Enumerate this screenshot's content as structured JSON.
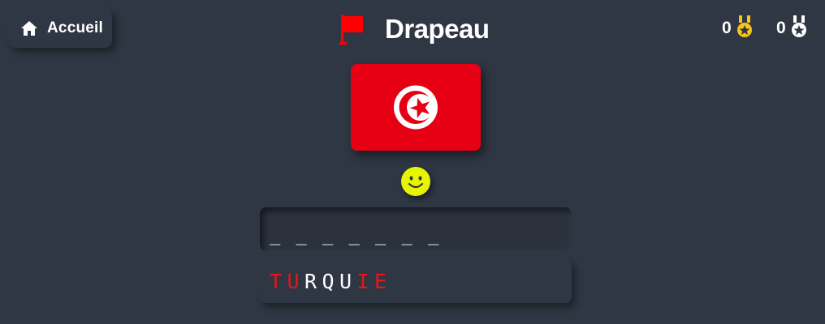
{
  "header": {
    "home_label": "Accueil",
    "home_icon": "home-icon",
    "title": "Drapeau",
    "title_icon": "flag-icon",
    "title_icon_color": "#ff0000"
  },
  "scores": {
    "gold": {
      "value": "0",
      "icon": "gold-medal-icon",
      "color": "#f5c518"
    },
    "silver": {
      "value": "0",
      "icon": "silver-medal-icon",
      "color": "#ffffff"
    }
  },
  "flag": {
    "country_icon": "tunisia-flag",
    "background_color": "#e70013"
  },
  "feedback": {
    "icon": "smiley-icon",
    "color": "#e8f500"
  },
  "answer": {
    "slots": "_ _ _ _ _ _ _"
  },
  "guess": {
    "letters": [
      {
        "char": "T",
        "status": "wrong"
      },
      {
        "char": "U",
        "status": "wrong"
      },
      {
        "char": "R",
        "status": "ok"
      },
      {
        "char": "Q",
        "status": "ok"
      },
      {
        "char": "U",
        "status": "ok"
      },
      {
        "char": "I",
        "status": "wrong"
      },
      {
        "char": "E",
        "status": "wrong"
      }
    ],
    "colors": {
      "wrong": "#e8151b",
      "ok": "#ffffff"
    }
  }
}
